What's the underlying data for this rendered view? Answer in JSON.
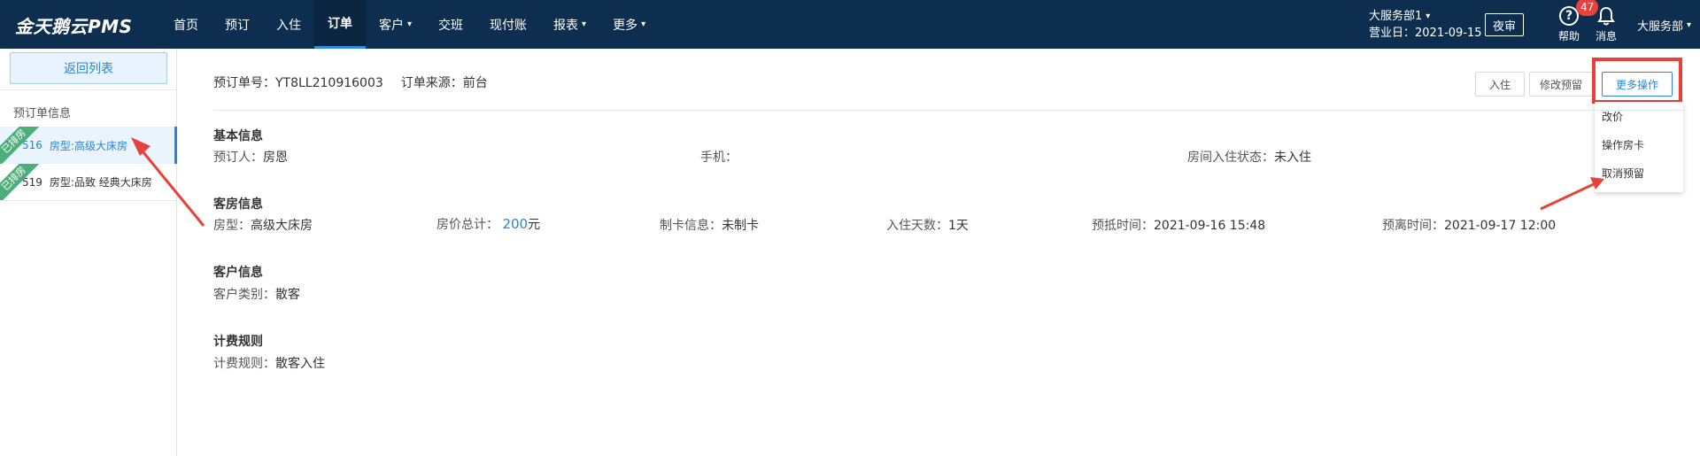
{
  "app": {
    "logo": "金天鹅云PMS"
  },
  "nav": {
    "items": [
      {
        "label": "首页",
        "caret": false
      },
      {
        "label": "预订",
        "caret": false
      },
      {
        "label": "入住",
        "caret": false
      },
      {
        "label": "订单",
        "caret": false,
        "active": true
      },
      {
        "label": "客户",
        "caret": true
      },
      {
        "label": "交班",
        "caret": false
      },
      {
        "label": "现付账",
        "caret": false
      },
      {
        "label": "报表",
        "caret": true
      },
      {
        "label": "更多",
        "caret": true
      }
    ]
  },
  "header": {
    "dept_name": "大服务部1",
    "business_date": "营业日：2021-09-15",
    "night_button": "夜审",
    "help_label": "帮助",
    "messages_label": "消息",
    "messages_count": "47",
    "user_name": "大服务部",
    "help_icon": "?",
    "caret_icon": "⌄"
  },
  "sidebar": {
    "back_button": "返回列表",
    "section_title": "预订单信息",
    "rooms": [
      {
        "ribbon": "已排房",
        "number": "516",
        "type": "房型:高级大床房"
      },
      {
        "ribbon": "已排房",
        "number": "519",
        "type": "房型:品致 经典大床房"
      }
    ]
  },
  "order": {
    "order_no": "预订单号：YT8LL210916003",
    "source": "订单来源：前台",
    "buttons": {
      "checkin": "入住",
      "modify": "修改预留",
      "more": "更多操作"
    },
    "more_menu": [
      "改价",
      "操作房卡",
      "取消预留"
    ]
  },
  "basic": {
    "title": "基本信息",
    "booker_label": "预订人：",
    "booker": "房恩",
    "phone_label": "手机：",
    "phone": "",
    "status_label": "房间入住状态：",
    "status": "未入住"
  },
  "room_info": {
    "title": "客房信息",
    "type_label": "房型：",
    "type": "高级大床房",
    "price_label": "房价总计：",
    "price": "200",
    "price_unit": "元",
    "card_label": "制卡信息：",
    "card": "未制卡",
    "days_label": "入住天数：",
    "days": "1天",
    "arrive_label": "预抵时间：",
    "arrive": "2021-09-16 15:48",
    "leave_label": "预离时间：",
    "leave": "2021-09-17 12:00"
  },
  "customer": {
    "title": "客户信息",
    "category_label": "客户类别：",
    "category": "散客"
  },
  "billing": {
    "title": "计费规则",
    "rule_label": "计费规则：",
    "rule": "散客入住"
  },
  "annotation": {
    "highlight_color": "#e8403a"
  }
}
